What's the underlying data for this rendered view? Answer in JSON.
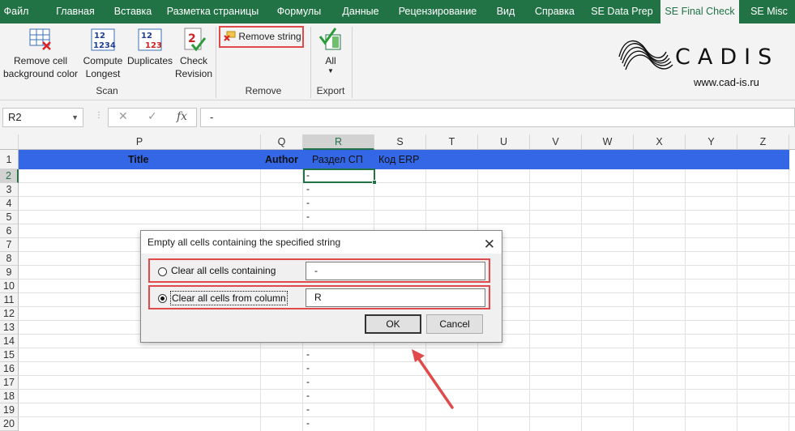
{
  "tabs": [
    "Файл",
    "Главная",
    "Вставка",
    "Разметка страницы",
    "Формулы",
    "Данные",
    "Рецензирование",
    "Вид",
    "Справка",
    "SE Data Prep",
    "SE Final Check",
    "SE Misc"
  ],
  "ribbon": {
    "remove_bg_line1": "Remove cell",
    "remove_bg_line2": "background color",
    "compute_line1": "Compute",
    "compute_line2": "Longest",
    "duplicates": "Duplicates",
    "check_line1": "Check",
    "check_line2": "Revision",
    "remove_string": "Remove string",
    "all": "All",
    "groups": {
      "scan": "Scan",
      "remove": "Remove",
      "export": "Export"
    }
  },
  "brand": {
    "name": "CADIS",
    "url": "www.cad-is.ru"
  },
  "formula_bar": {
    "cell_ref": "R2",
    "value": "-"
  },
  "grid": {
    "columns": [
      "P",
      "Q",
      "R",
      "S",
      "T",
      "U",
      "V",
      "W",
      "X",
      "Y",
      "Z"
    ],
    "rows": [
      "1",
      "2",
      "3",
      "4",
      "5",
      "6",
      "7",
      "8",
      "9",
      "10",
      "11",
      "12",
      "13",
      "14",
      "15",
      "16",
      "17",
      "18",
      "19",
      "20"
    ],
    "header_row": {
      "title": "Title",
      "author": "Author",
      "razdel": "Раздел СП",
      "kod": "Код ERP"
    },
    "dash": "-"
  },
  "dialog": {
    "title": "Empty all cells containing the specified string",
    "option1_label": "Clear all cells containing",
    "option1_value": "-",
    "option2_label": "Clear all cells from column",
    "option2_value": "R",
    "ok": "OK",
    "cancel": "Cancel"
  },
  "colors": {
    "excel_green": "#217346",
    "header_blue": "#3367e6",
    "highlight_red": "#e04a4a"
  }
}
